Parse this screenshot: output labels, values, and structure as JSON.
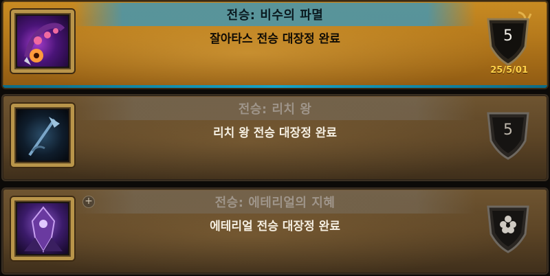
{
  "achievements": [
    {
      "title": "전승: 비수의 파멸",
      "description": "잘아타스 전승 대장정 완료",
      "points": "5",
      "date": "25/5/01",
      "state": "completed",
      "icon": "purple-beast-crest-icon"
    },
    {
      "title": "전승: 리치 왕",
      "description": "리치 왕 전승 대장정 완료",
      "points": "5",
      "state": "locked",
      "icon": "frostmourne-lich-king-icon"
    },
    {
      "title": "전승: 에테리얼의 지혜",
      "description": "에테리얼 전승 대장정 완료",
      "state": "locked",
      "icon": "ethereal-figure-icon",
      "shield_icon": "flower-emblem-icon",
      "expand_label": "+"
    }
  ],
  "colors": {
    "completed_bg": "#b67a1c",
    "title_bar_completed": "#4696af",
    "date_gold": "#ffd24a",
    "locked_bg": "#5d4526"
  }
}
